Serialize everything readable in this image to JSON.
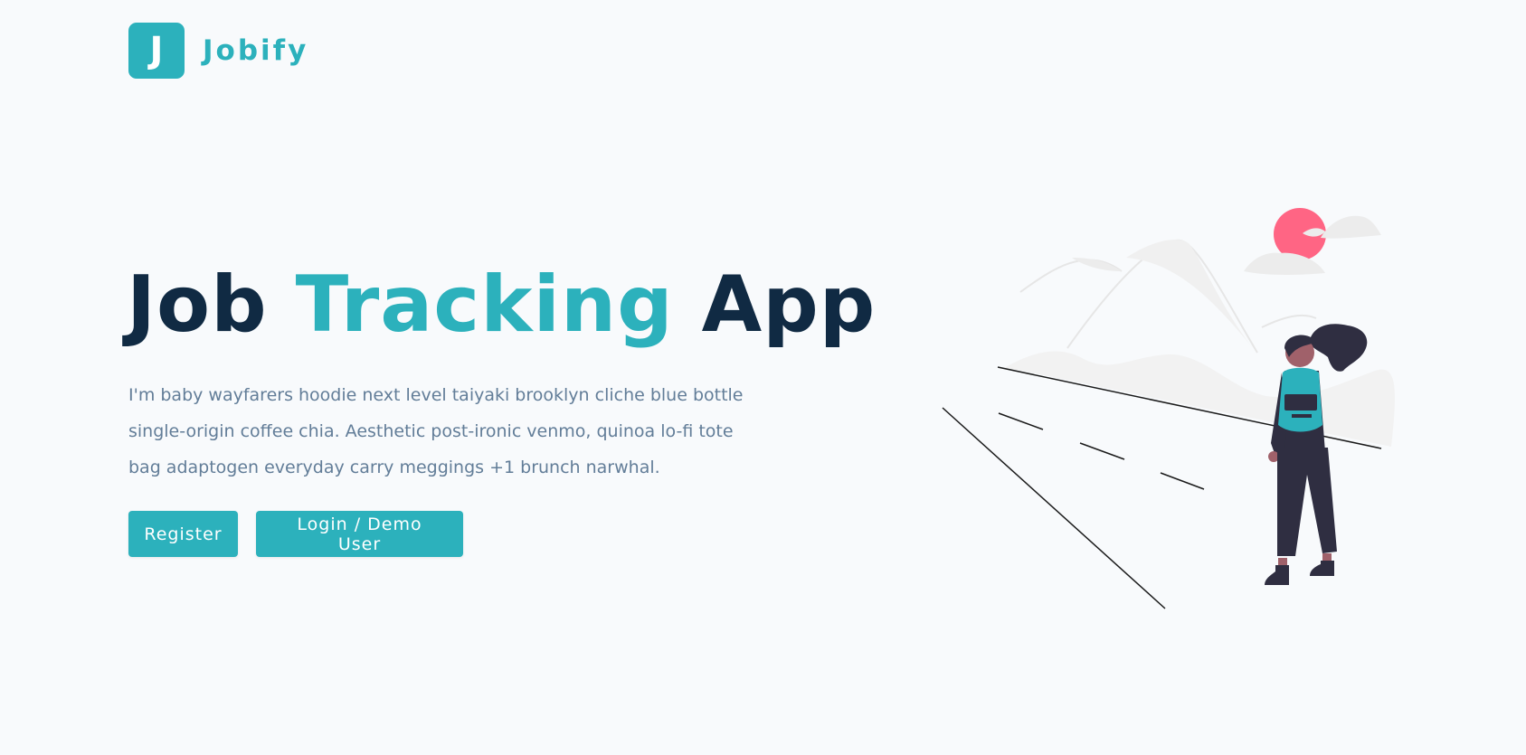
{
  "brand": {
    "logo_letter": "J",
    "name": "Jobify",
    "color": "#2cb1bc"
  },
  "hero": {
    "title_part1": "Job",
    "title_accent": "Tracking",
    "title_part2": "App",
    "description": "I'm baby wayfarers hoodie next level taiyaki brooklyn cliche blue bottle single-origin coffee chia. Aesthetic post-ironic venmo, quinoa lo-fi tote bag adaptogen everyday carry meggings +1 brunch narwhal."
  },
  "buttons": {
    "register_label": "Register",
    "login_label": "Login / Demo User"
  },
  "illustration": {
    "icon": "woman-traveler-landscape-illustration",
    "colors": {
      "sun": "#ff6584",
      "backpack": "#2cb1bc",
      "figure": "#2f2e41",
      "hills": "#f2f2f2"
    }
  },
  "colors": {
    "primary": "#2cb1bc",
    "heading": "#102a43",
    "body_text": "#627d98",
    "background": "#f8fafc"
  }
}
